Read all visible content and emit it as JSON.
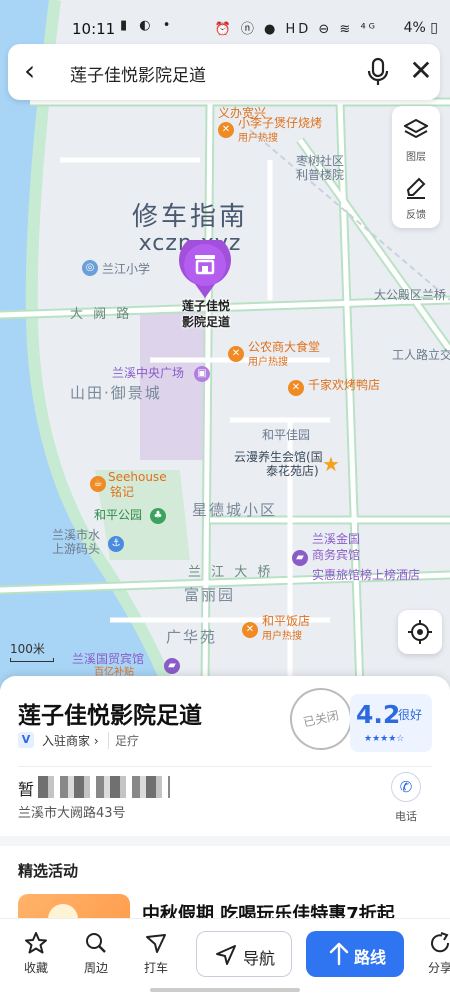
{
  "status_bar": {
    "time": "10:11",
    "left_icons": "▮ ◐ •",
    "right_icons": "⏰ ⓝ ● HD ⊖ ≋ ⁴ᴳ",
    "battery": "4% ▯"
  },
  "search": {
    "query": "莲子佳悦影院足道",
    "back_icon": "back-arrow-icon",
    "mic_icon": "microphone-icon",
    "close_icon": "close-icon"
  },
  "map_tools": {
    "layers_label": "图层",
    "feedback_label": "反馈"
  },
  "watermark": {
    "cn": "修车指南",
    "en": "xczn.xyz"
  },
  "selected_place": {
    "pin_label_line1": "莲子佳悦",
    "pin_label_line2": "影院足道"
  },
  "map_labels": {
    "top_partial": "义办宽兴",
    "lizi": "小李子煲仔烧烤",
    "lizi_sub": "用户热搜",
    "village": "枣树社区",
    "village2": "利普楼院",
    "school": "兰江小学",
    "dayue_road": "大 阙 路",
    "gongnong": "公农商大食堂",
    "gongnong_sub": "用户热搜",
    "zhongyang": "兰溪中央广场",
    "shantian": "山田·御景城",
    "qianjia": "千家欢烤鸭店",
    "heping_jia": "和平佳园",
    "yunman": "云漫养生会馆(国",
    "yunman2": "泰花苑店)",
    "coffee": "Seehouse",
    "coffee2": "铭记",
    "heping_park": "和平公园",
    "xingde": "星德城小区",
    "pier": "兰溪市水",
    "pier2": "上游码头",
    "jinguo": "兰溪金国",
    "jinguo2": "商务宾馆",
    "shihui": "实惠旅馆榜上榜酒店",
    "bridge": "兰 江 大 桥",
    "fuli": "富丽园",
    "guanghua": "广华苑",
    "heping_hotel": "和平饭店",
    "heping_hotel_sub": "用户热搜",
    "guomao": "兰溪国贸宾馆",
    "guomao2": "百亿补贴",
    "dayuan": "大公殿区兰桥",
    "gongren": "工人路立交桥"
  },
  "scale": {
    "label": "100米"
  },
  "place": {
    "name": "莲子佳悦影院足道",
    "badge": "V",
    "merchant_tag": "入驻商家 ›",
    "category": "足疗",
    "status_stamp": "已关闭",
    "rating": "4.2",
    "rating_desc": "很好",
    "stars": "★★★★☆",
    "hours_prefix": "暂",
    "address": "兰溪市大阙路43号",
    "call_label": "电话"
  },
  "activity": {
    "section_title": "精选活动",
    "promo_title": "中秋假期 吃喝玩乐佳特惠7折起"
  },
  "bottom_nav": {
    "favorite": "收藏",
    "nearby": "周边",
    "taxi": "打车",
    "navigate": "导航",
    "route": "路线",
    "share": "分享"
  },
  "colors": {
    "accent": "#2f74f0",
    "pin": "#a24fdc",
    "poi_orange": "#f08a24"
  }
}
